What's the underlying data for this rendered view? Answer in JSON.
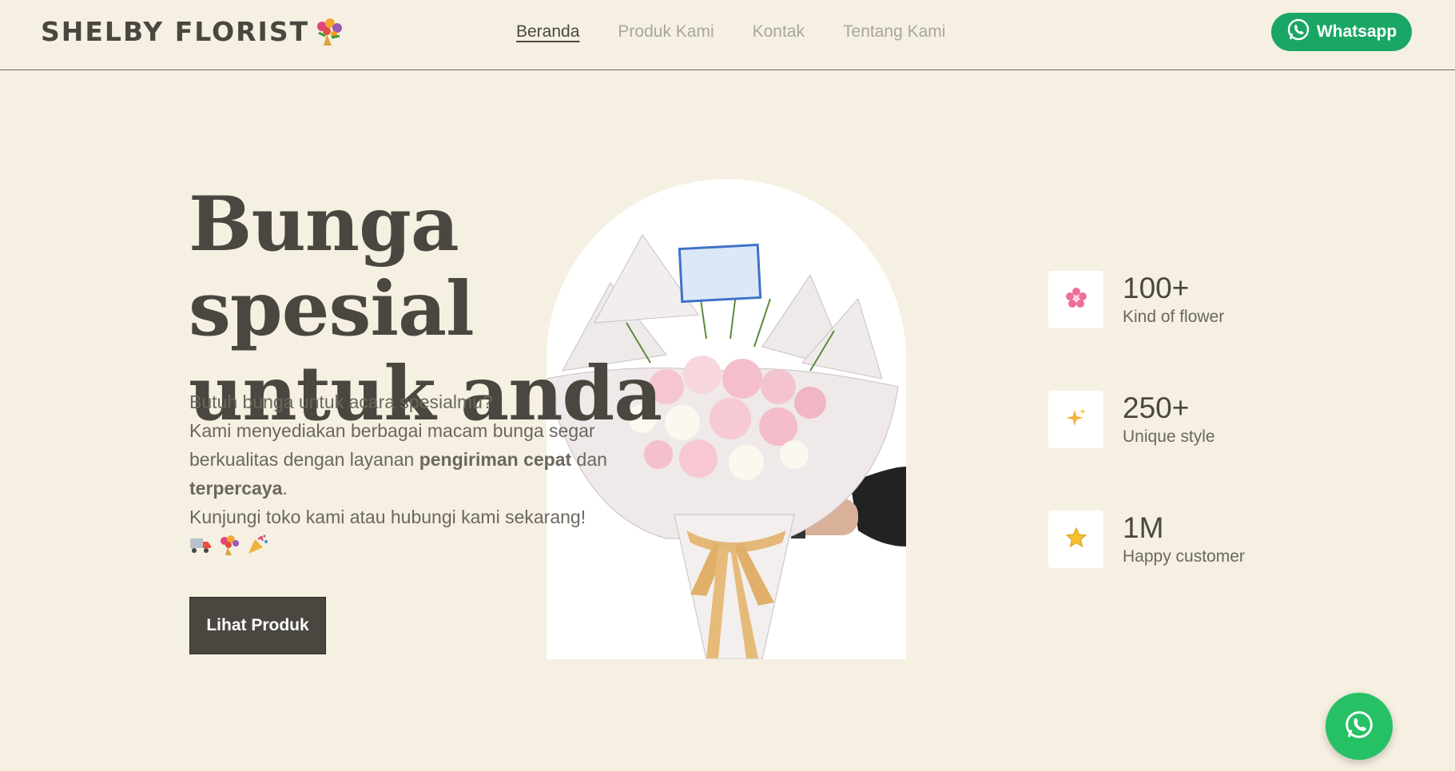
{
  "brand": {
    "name": "SHELBY FLORIST",
    "logo_icon": "bouquet-icon"
  },
  "nav": {
    "items": [
      {
        "label": "Beranda",
        "active": true
      },
      {
        "label": "Produk Kami",
        "active": false
      },
      {
        "label": "Kontak",
        "active": false
      },
      {
        "label": "Tentang Kami",
        "active": false
      }
    ]
  },
  "header": {
    "whatsapp_label": "Whatsapp"
  },
  "hero": {
    "title_line1": "Bunga spesial",
    "title_line2": "untuk anda",
    "desc_line1": "Butuh bunga untuk acara spesialmu?",
    "desc_line2_a": "Kami menyediakan berbagai macam bunga segar berkualitas dengan layanan ",
    "desc_bold1": "pengiriman cepat",
    "desc_mid": " dan ",
    "desc_bold2": "terpercaya",
    "desc_end": ".",
    "desc_line3": "Kunjungi toko kami atau hubungi kami sekarang!",
    "emojis": [
      "truck-icon",
      "bouquet-icon",
      "party-popper-icon"
    ],
    "cta_label": "Lihat Produk"
  },
  "stats": [
    {
      "value": "100+",
      "label": "Kind of flower",
      "icon": "cherry-blossom-icon"
    },
    {
      "value": "250+",
      "label": "Unique style",
      "icon": "sparkles-icon"
    },
    {
      "value": "1M",
      "label": "Happy customer",
      "icon": "star-icon"
    }
  ],
  "colors": {
    "background": "#f5f0e1",
    "text_dark": "#4a4740",
    "whatsapp_green": "#1aa665",
    "fab_green": "#26c165"
  }
}
